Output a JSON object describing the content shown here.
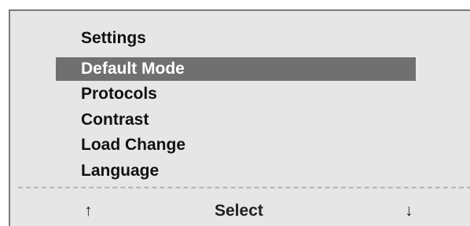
{
  "menu": {
    "title": "Settings",
    "items": [
      {
        "label": "Default Mode",
        "selected": true
      },
      {
        "label": "Protocols",
        "selected": false
      },
      {
        "label": "Contrast",
        "selected": false
      },
      {
        "label": "Load Change",
        "selected": false
      },
      {
        "label": "Language",
        "selected": false
      }
    ]
  },
  "softkeys": {
    "up": {
      "glyph": "↑",
      "icon": "arrow-up-icon"
    },
    "select": {
      "label": "Select"
    },
    "down": {
      "glyph": "↓",
      "icon": "arrow-down-icon"
    }
  },
  "colors": {
    "screen_background": "#e6e6e6",
    "selection_background": "#707070",
    "selection_text": "#ffffff",
    "text": "#111111"
  }
}
